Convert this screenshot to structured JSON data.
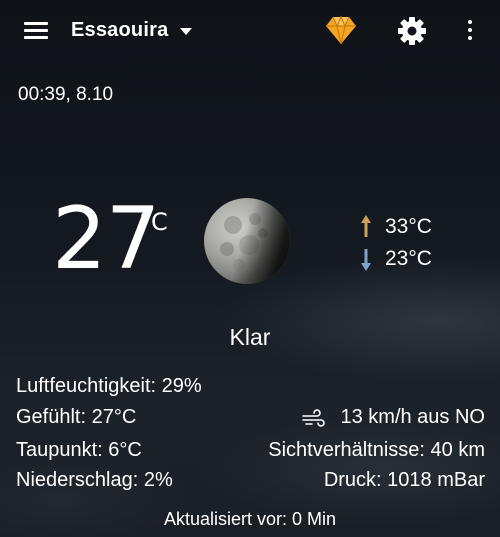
{
  "app": {
    "location": "Essaouira",
    "datetime": "00:39, 8.10"
  },
  "toolbar": {
    "menu_icon": "hamburger-menu-icon",
    "dropdown_icon": "caret-down-icon",
    "premium_icon": "diamond-icon",
    "settings_icon": "gear-icon",
    "overflow_icon": "more-vertical-icon",
    "premium_color": "#F5A623"
  },
  "current": {
    "temperature": "27",
    "unit": "°C",
    "condition_icon": "moon-icon",
    "condition": "Klar",
    "high": "33°C",
    "low": "23°C",
    "high_arrow_color": "#C9A35A",
    "low_arrow_color": "#7FA3C8"
  },
  "details": {
    "humidity": "Luftfeuchtigkeit: 29%",
    "feels_like": "Gefühlt: 27°C",
    "dew_point": "Taupunkt: 6°C",
    "precipitation": "Niederschlag: 2%",
    "wind": "13 km/h aus NO",
    "visibility": "Sichtverhältnisse: 40 km",
    "pressure": "Druck: 1018 mBar"
  },
  "footer": {
    "updated": "Aktualisiert vor: 0 Min"
  }
}
